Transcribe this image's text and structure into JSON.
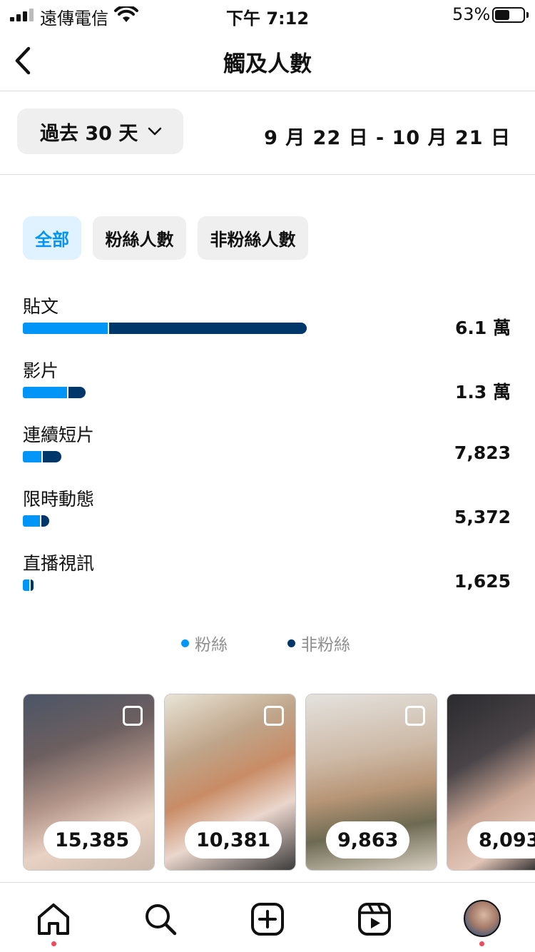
{
  "status_bar": {
    "carrier": "遠傳電信",
    "time": "下午 7:12",
    "battery_pct": "53%",
    "battery_level": 0.53
  },
  "header": {
    "title": "觸及人數",
    "back_icon": "chevron-left-icon"
  },
  "range": {
    "selector_label": "過去 30 天",
    "date_range": "9 月 22 日 - 10 月 21 日"
  },
  "filters": [
    {
      "label": "全部",
      "active": true
    },
    {
      "label": "粉絲人數",
      "active": false
    },
    {
      "label": "非粉絲人數",
      "active": false
    }
  ],
  "metrics": [
    {
      "label": "貼文",
      "value_text": "6.1 萬",
      "followers_fraction": 0.3,
      "total_fraction": 1.0
    },
    {
      "label": "影片",
      "value_text": "1.3 萬",
      "followers_fraction": 0.72,
      "total_fraction": 0.22
    },
    {
      "label": "連續短片",
      "value_text": "7,823",
      "followers_fraction": 0.5,
      "total_fraction": 0.135
    },
    {
      "label": "限時動態",
      "value_text": "5,372",
      "followers_fraction": 0.68,
      "total_fraction": 0.093
    },
    {
      "label": "直播視訊",
      "value_text": "1,625",
      "followers_fraction": 0.85,
      "total_fraction": 0.032
    }
  ],
  "legend": {
    "followers": "粉絲",
    "non_followers": "非粉絲"
  },
  "colors": {
    "followers": "#0095f6",
    "non_followers": "#00376b",
    "active_chip_bg": "#e0f1ff",
    "notification_dot": "#ed4956"
  },
  "posts": [
    {
      "count": "15,385"
    },
    {
      "count": "10,381"
    },
    {
      "count": "9,863"
    },
    {
      "count": "8,093"
    }
  ],
  "tabbar": {
    "icons": [
      "home-icon",
      "search-icon",
      "create-icon",
      "reels-icon",
      "profile-avatar"
    ]
  }
}
